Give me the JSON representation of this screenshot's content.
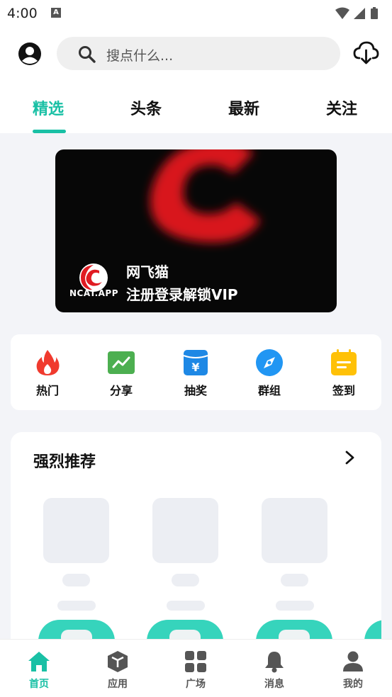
{
  "status_bar": {
    "time": "4:00",
    "notification_letter": "A"
  },
  "header": {
    "search_placeholder": "搜点什么..."
  },
  "tabs": [
    {
      "label": "精选",
      "active": true
    },
    {
      "label": "头条",
      "active": false
    },
    {
      "label": "最新",
      "active": false
    },
    {
      "label": "关注",
      "active": false
    }
  ],
  "banner": {
    "logo_text": "NCAT.APP",
    "title": "网飞猫",
    "subtitle": "注册登录解锁VIP"
  },
  "quick_actions": [
    {
      "label": "热门",
      "icon": "fire-icon"
    },
    {
      "label": "分享",
      "icon": "chart-trend-icon"
    },
    {
      "label": "抽奖",
      "icon": "lottery-yen-icon"
    },
    {
      "label": "群组",
      "icon": "compass-icon"
    },
    {
      "label": "签到",
      "icon": "calendar-checkin-icon"
    }
  ],
  "recommend": {
    "title": "强烈推荐"
  },
  "bottom_nav": [
    {
      "label": "首页",
      "icon": "home-icon",
      "active": true
    },
    {
      "label": "应用",
      "icon": "cube-icon",
      "active": false
    },
    {
      "label": "广场",
      "icon": "grid-icon",
      "active": false
    },
    {
      "label": "消息",
      "icon": "bell-icon",
      "active": false
    },
    {
      "label": "我的",
      "icon": "user-icon",
      "active": false
    }
  ],
  "colors": {
    "accent": "#19c0a5",
    "accent_button": "#36d4bc",
    "page_bg": "#f3f4f8",
    "placeholder": "#eceef3",
    "fire": "#f03a2e",
    "share_green": "#4caf50",
    "lottery_blue": "#1e88e5",
    "compass_blue": "#2196f3",
    "checkin_yellow": "#ffc107"
  }
}
